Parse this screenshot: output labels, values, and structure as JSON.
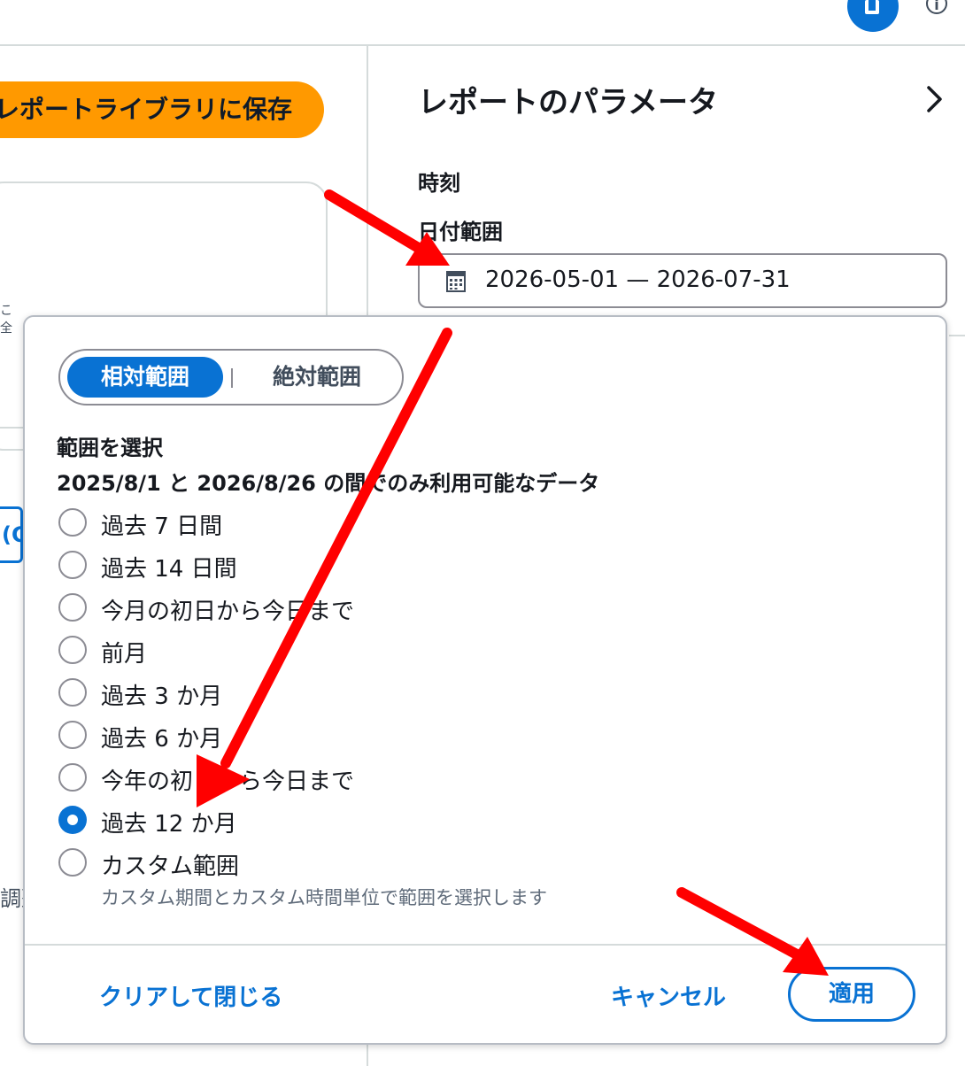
{
  "left": {
    "save_button_label": "レポートライブラリに保存",
    "tab_fragment": "(C",
    "side_char_1": "こ",
    "side_char_2": "全",
    "side_char_3": "調整"
  },
  "panel": {
    "title": "レポートのパラメータ",
    "time_label": "時刻",
    "date_range_label": "日付範囲",
    "date_range_value": "2026-05-01 — 2026-07-31"
  },
  "popover": {
    "tabs": {
      "relative": "相対範囲",
      "absolute": "絶対範囲",
      "active": "relative"
    },
    "choose_label": "範囲を選択",
    "availability": "2025/8/1 と 2026/8/26 の間でのみ利用可能なデータ",
    "options": [
      {
        "label": "過去 7 日間",
        "selected": false
      },
      {
        "label": "過去 14 日間",
        "selected": false
      },
      {
        "label": "今月の初日から今日まで",
        "selected": false
      },
      {
        "label": "前月",
        "selected": false
      },
      {
        "label": "過去 3 か月",
        "selected": false
      },
      {
        "label": "過去 6 か月",
        "selected": false
      },
      {
        "label": "今年の初日から今日まで",
        "selected": false
      },
      {
        "label": "過去 12 か月",
        "selected": true
      },
      {
        "label": "カスタム範囲",
        "selected": false
      }
    ],
    "custom_description": "カスタム期間とカスタム時間単位で範囲を選択します",
    "footer": {
      "clear_label": "クリアして閉じる",
      "cancel_label": "キャンセル",
      "apply_label": "適用"
    }
  },
  "colors": {
    "accent": "#0972d3",
    "save_button": "#ff9900",
    "annotation_arrow": "#ff0000"
  },
  "icons": [
    "calendar-icon",
    "chevron-right-icon",
    "info-icon"
  ]
}
